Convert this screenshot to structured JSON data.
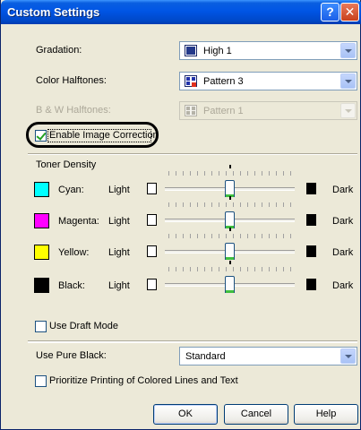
{
  "window": {
    "title": "Custom Settings",
    "help_glyph": "?",
    "close_glyph": "✕"
  },
  "gradation": {
    "label": "Gradation:",
    "value": "High 1"
  },
  "color_halftones": {
    "label": "Color Halftones:",
    "value": "Pattern 3"
  },
  "bw_halftones": {
    "label": "B & W Halftones:",
    "value": "Pattern 1"
  },
  "image_correction": {
    "label": "Enable Image Correction",
    "checked": true
  },
  "toner_density": {
    "heading": "Toner Density",
    "light_label": "Light",
    "dark_label": "Dark",
    "channels": [
      {
        "name": "Cyan:",
        "color": "#00ffff",
        "level": 0.5
      },
      {
        "name": "Magenta:",
        "color": "#ff00ff",
        "level": 0.5
      },
      {
        "name": "Yellow:",
        "color": "#ffff00",
        "level": 0.5
      },
      {
        "name": "Black:",
        "color": "#000000",
        "level": 0.5
      }
    ]
  },
  "draft_mode": {
    "label": "Use Draft Mode",
    "checked": false
  },
  "pure_black": {
    "label": "Use Pure Black:",
    "value": "Standard"
  },
  "prioritize": {
    "label": "Prioritize Printing of Colored Lines and Text",
    "checked": false
  },
  "buttons": {
    "ok": "OK",
    "cancel": "Cancel",
    "help": "Help"
  },
  "colors": {
    "title_bar": "#0055e5",
    "dialog_bg": "#ece9d8",
    "thumb_accent": "#3fbf3f"
  }
}
